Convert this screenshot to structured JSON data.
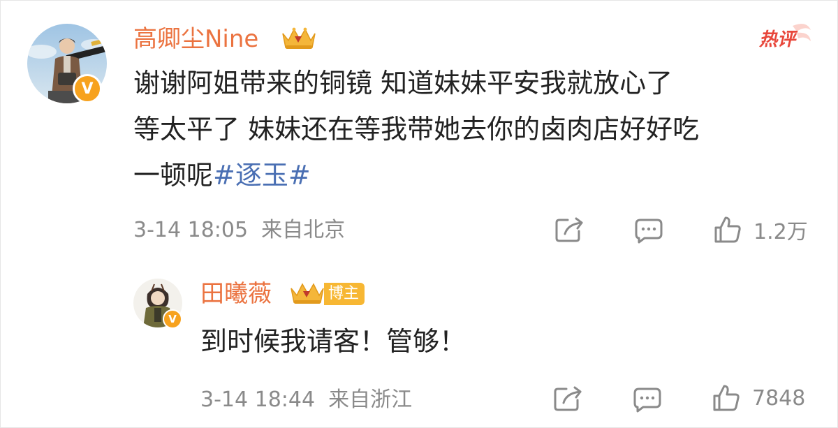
{
  "main_comment": {
    "username": "高卿尘Nine",
    "hot_label": "热评",
    "text_lines": [
      "谢谢阿姐带来的铜镜  知道妹妹平安我就放心了",
      "等太平了 妹妹还在等我带她去你的卤肉店好好吃",
      "一顿呢"
    ],
    "hashtag": "#逐玉#",
    "timestamp": "3-14 18:05",
    "location": "来自北京",
    "likes": "1.2万",
    "verified_badge": "V",
    "icons": [
      "share-icon",
      "comment-icon",
      "like-icon",
      "crown-icon"
    ]
  },
  "reply": {
    "username": "田曦薇",
    "blogger_tag": "博主",
    "text": "到时候我请客！管够！",
    "timestamp": "3-14 18:44",
    "location": "来自浙江",
    "likes": "7848",
    "verified_badge": "V"
  },
  "colors": {
    "username": "#eb7340",
    "hashtag": "#4a6fb3",
    "meta": "#8a8a8a",
    "hot": "#e8473b",
    "badge": "#f7a21e"
  }
}
